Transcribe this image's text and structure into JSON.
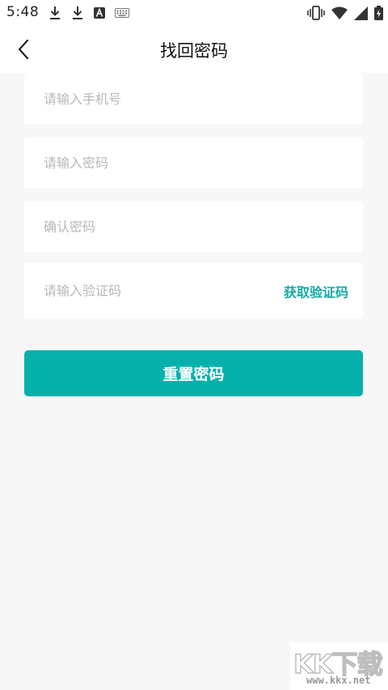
{
  "status_bar": {
    "time": "5:48",
    "left_icons": [
      "download-icon",
      "download-icon",
      "font-a-icon",
      "keyboard-icon"
    ],
    "right_icons": [
      "vibrate-icon",
      "wifi-icon",
      "signal-icon",
      "battery-charging-icon"
    ]
  },
  "header": {
    "title": "找回密码"
  },
  "form": {
    "phone_placeholder": "请输入手机号",
    "password_placeholder": "请输入密码",
    "confirm_placeholder": "确认密码",
    "code_placeholder": "请输入验证码",
    "get_code_label": "获取验证码"
  },
  "submit": {
    "label": "重置密码"
  },
  "watermark": {
    "logo": "KK下载",
    "url": "www.kkx.net"
  },
  "colors": {
    "accent": "#06b1ac",
    "accent_text": "#12aaa4",
    "background": "#f7f7f7"
  }
}
